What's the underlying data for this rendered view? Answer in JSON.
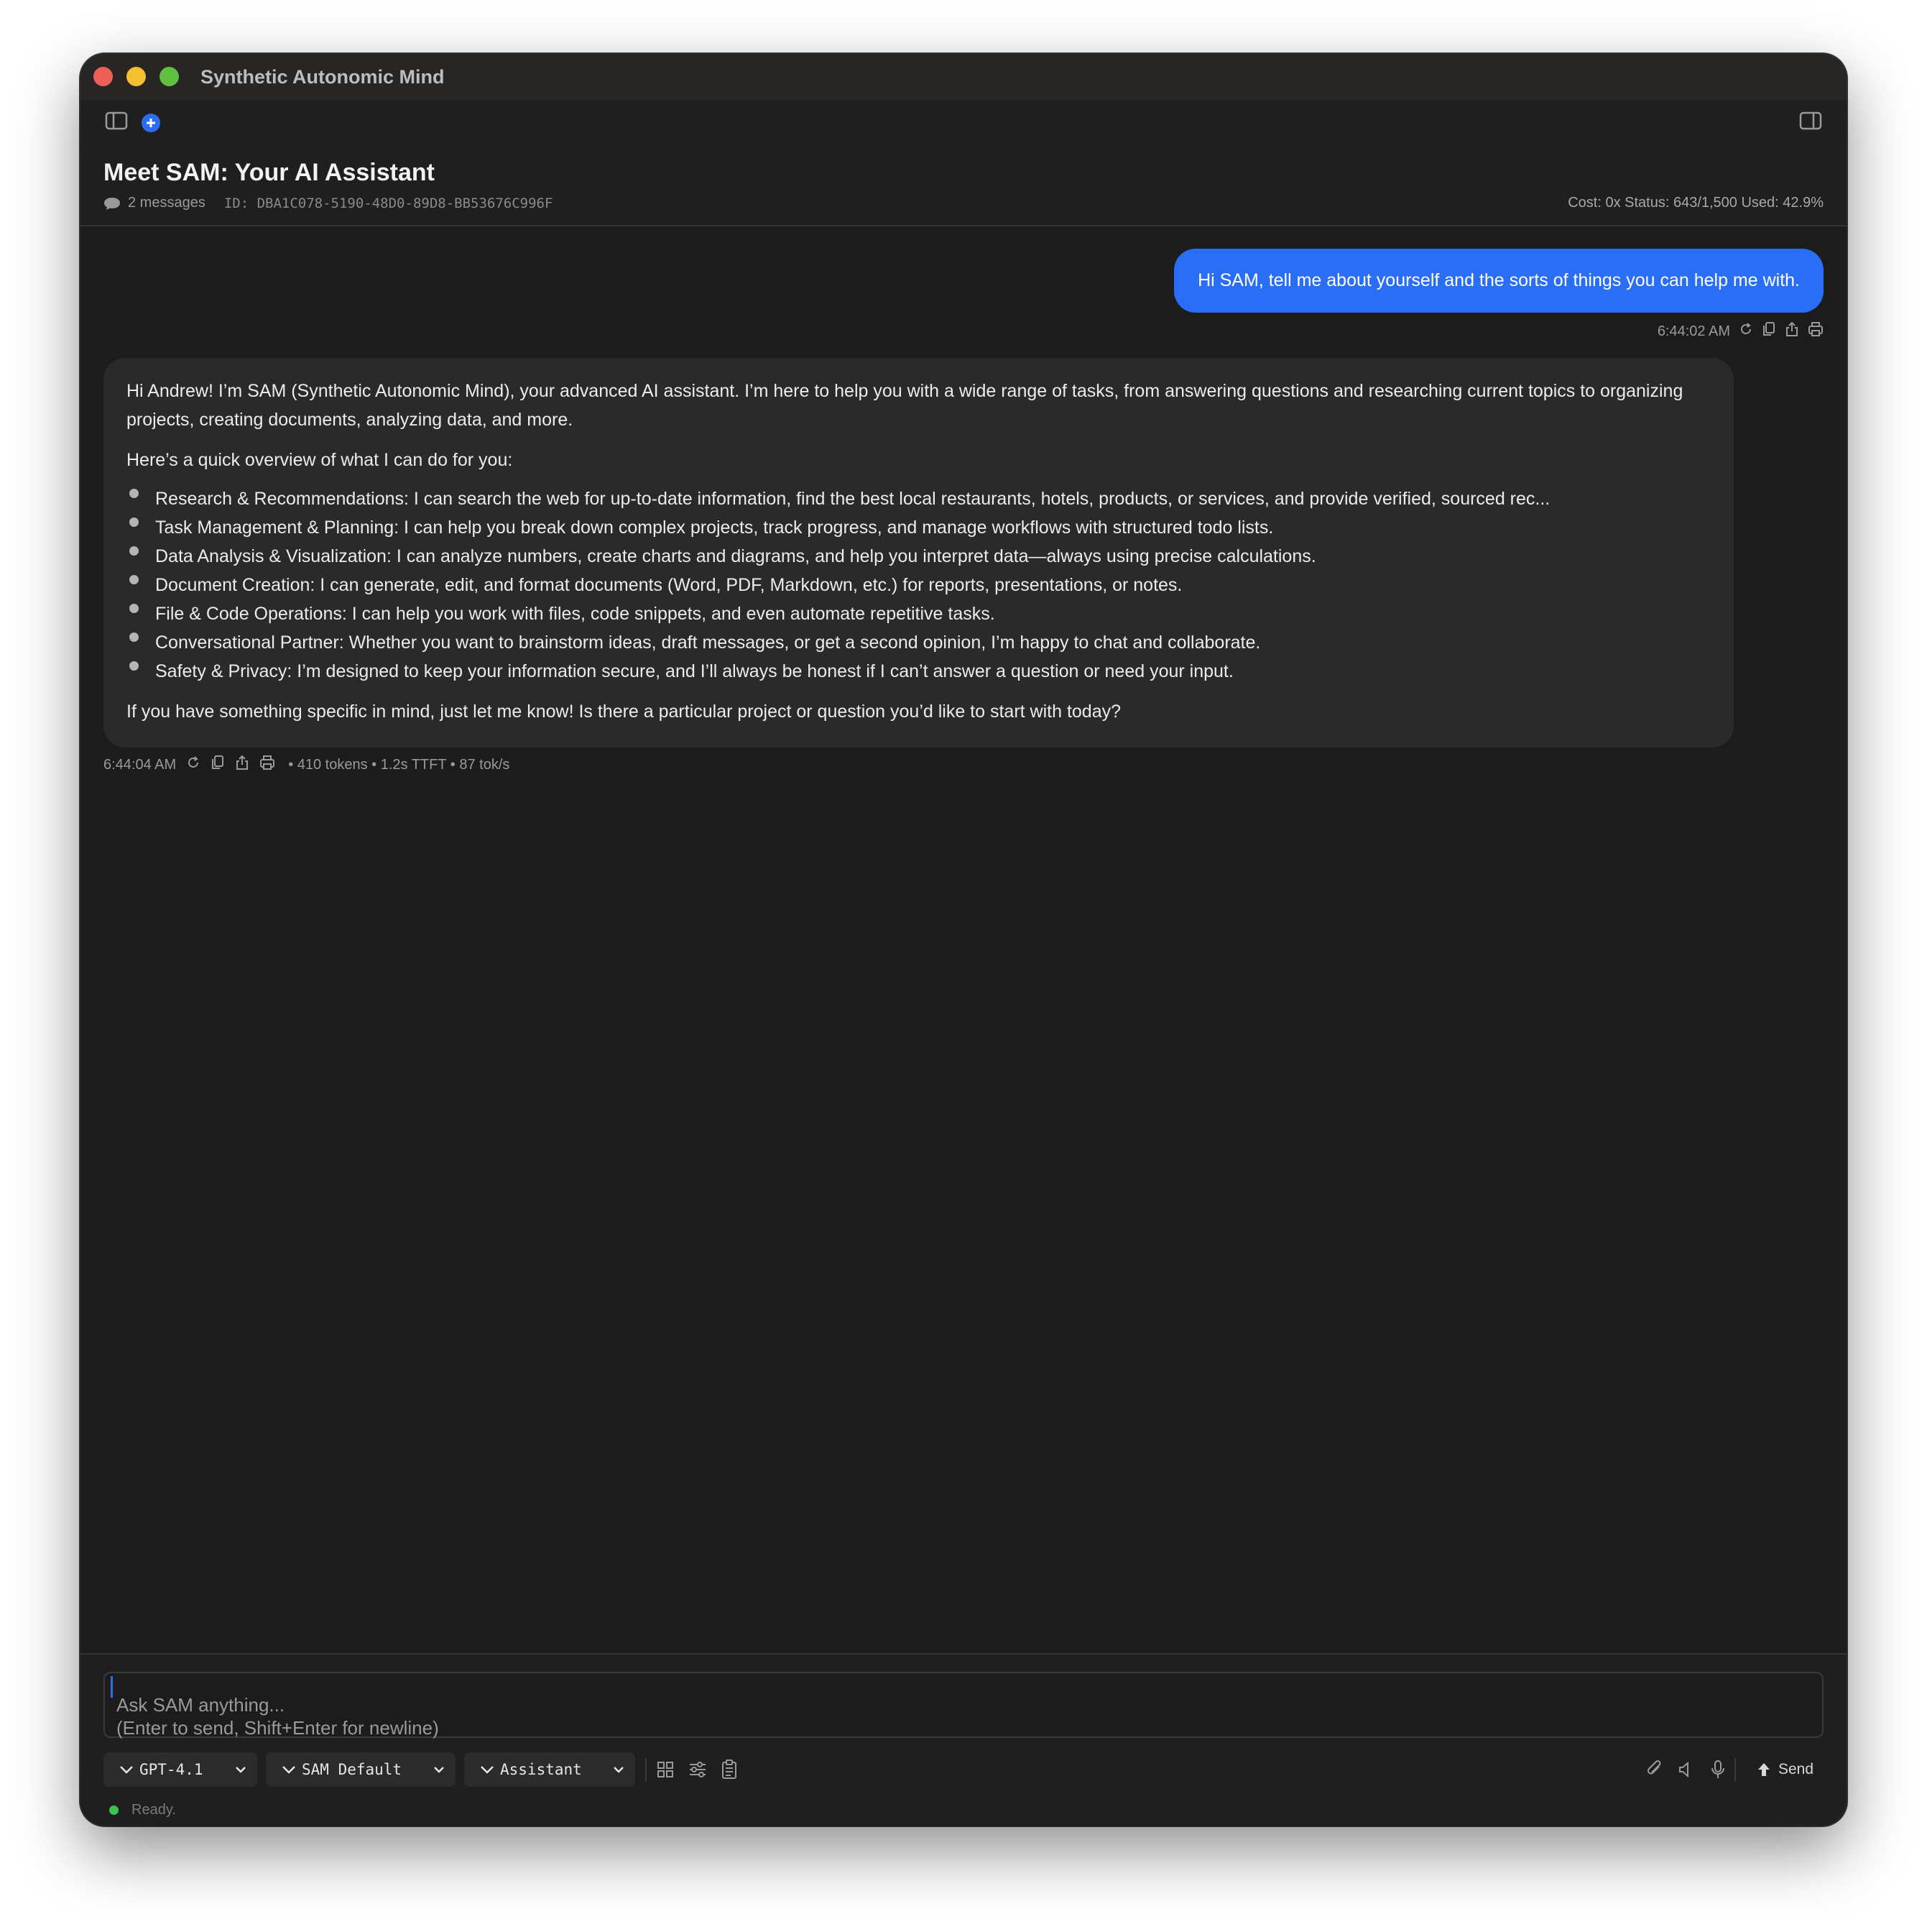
{
  "app": {
    "title": "Synthetic Autonomic Mind"
  },
  "conversation": {
    "title": "Meet SAM: Your AI Assistant",
    "message_count": "2 messages",
    "id": "ID: DBA1C078-5190-48D0-89D8-BB53676C996F",
    "stats": "Cost: 0x  Status: 643/1,500  Used: 42.9%"
  },
  "messages": {
    "user": {
      "text": "Hi SAM, tell me about yourself and the sorts of things you can help me with.",
      "time": "6:44:02 AM"
    },
    "assistant": {
      "intro": "Hi Andrew! I’m SAM (Synthetic Autonomic Mind), your advanced AI assistant. I’m here to help you with a wide range of tasks, from answering questions and researching current topics to organizing projects, creating documents, analyzing data, and more.",
      "overview": "Here’s a quick overview of what I can do for you:",
      "bullets": [
        "Research & Recommendations: I can search the web for up-to-date information, find the best local restaurants, hotels, products, or services, and provide verified, sourced rec...",
        "Task Management & Planning: I can help you break down complex projects, track progress, and manage workflows with structured todo lists.",
        "Data Analysis & Visualization: I can analyze numbers, create charts and diagrams, and help you interpret data—always using precise calculations.",
        "Document Creation: I can generate, edit, and format documents (Word, PDF, Markdown, etc.) for reports, presentations, or notes.",
        "File & Code Operations: I can help you work with files, code snippets, and even automate repetitive tasks.",
        "Conversational Partner: Whether you want to brainstorm ideas, draft messages, or get a second opinion, I’m happy to chat and collaborate.",
        "Safety & Privacy: I’m designed to keep your information secure, and I’ll always be honest if I can’t answer a question or need your input."
      ],
      "closing": "If you have something specific in mind, just let me know! Is there a particular project or question you’d like to start with today?",
      "time": "6:44:04 AM",
      "stats": "• 410 tokens • 1.2s TTFT • 87 tok/s"
    }
  },
  "composer": {
    "placeholder_line1": "Ask SAM anything...",
    "placeholder_line2": "(Enter to send, Shift+Enter for newline)",
    "model": "GPT-4.1",
    "prompt": "SAM Default",
    "persona": "Assistant",
    "send_label": "Send"
  },
  "status": {
    "text": "Ready."
  },
  "colors": {
    "accent": "#2a6ef5",
    "status_ready": "#3ec24b",
    "window_bg": "#1c1c1c"
  }
}
